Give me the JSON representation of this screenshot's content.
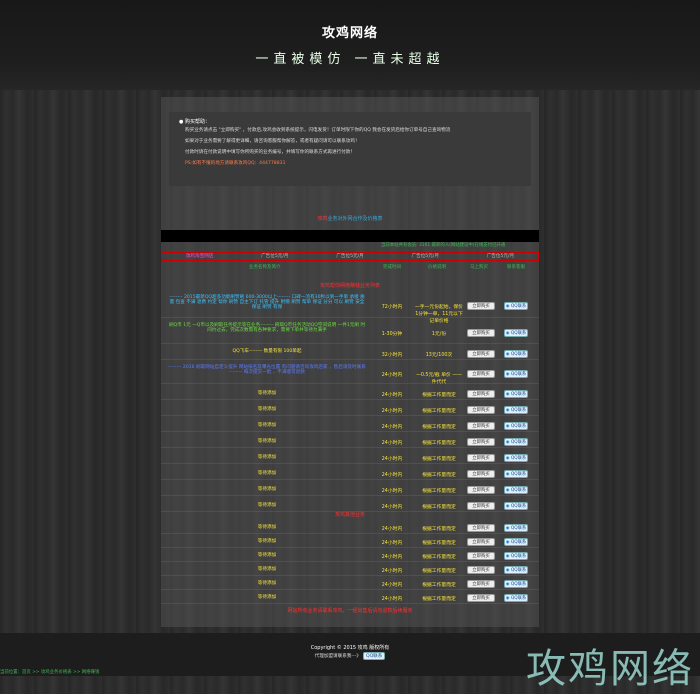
{
  "header": {
    "site_name": "攻鸡网络",
    "slogan": "一直被模仿 一直未超越"
  },
  "notice": {
    "title": "购买帮助：",
    "lines": [
      "购买业务请点击 \"立即购买\" ，付款后,攻鸡会收到系统提示，闪电发货！订单时限下你的QQ 我会在发货后给你订单号自己查询物流",
      "如果对于业务需要了解得更详细，请咨询客服帮你解答，或者有疑问请可以联系攻鸡！",
      "付款时请在付款说明中填写你所购买的业务编号，并填写你的联系方式再进行付款！",
      "PS:如有不懂的地方请联系攻鸡QQ：444778831"
    ]
  },
  "subtitle": {
    "red": "攻鸡",
    "rest": "业务对外网合作及价格表"
  },
  "stats": "当前本站共有会员: 3161 最新的人(网站建设中)在线支付已开通",
  "ads": [
    "攻鸡淘宝网店",
    "广告位5元/月",
    "广告位5元/月",
    "广告位5元/月",
    "广告位5元/月"
  ],
  "columns": [
    "业务名称及简介",
    "完成时间",
    "价格说明",
    "马上购买",
    "联系客服"
  ],
  "section_title": "攻鸡帮你网络赚钱业务列表",
  "section2_title": "攻鸡其他业务",
  "buy_label": "立即购买",
  "qq_label": "QQ联系",
  "rows": [
    {
      "desc": "-------- 2015最新QQ超多功能刷赞刷 600-3000以上-------- 口碑一流有30秒以到一手单 承接 质量 包查 不满 退费 约定 帮你 刷赞 自主下订 托管 提升 附赠 刷赞 帮单 保证 分分 可以 刷赞 安全 保证 刷赞 有保",
      "time": "72小时内",
      "price": "一手一元份起始，保价1分钟一单，11元以下记单价格",
      "h": 24
    },
    {
      "desc": "刷Q币 1元 一Q币以及刷取任务提示等在业务-------- 刷取Q币任务活动QQ空间说明 一件1元刷 时间约过去，完成次数需有各种要求，需要下单并等待为满手",
      "time": "1-30分钟",
      "price": "1元/份",
      "h": 22
    },
    {
      "desc": "QQ飞车-------- 数量有限 100单起",
      "time": "32小时内",
      "price": "13元/100次",
      "h": 12
    },
    {
      "desc": "-------- 2016 刷取网站自定义提升 网站排名及曝光位置 有问题请咨询攻鸡店家 ，售后请及时联系 -------- 每次提交一批 ，不满意可退款",
      "time": "24小时内",
      "price": "一0.5元/截 单价 一一件代代",
      "h": 20
    },
    {
      "desc": "等待添加",
      "time": "24小时内",
      "price": "根据工作量而定",
      "h": 12
    },
    {
      "desc": "等待添加",
      "time": "24小时内",
      "price": "根据工作量而定",
      "h": 12
    },
    {
      "desc": "等待添加",
      "time": "24小时内",
      "price": "根据工作量而定",
      "h": 12
    },
    {
      "desc": "等待添加",
      "time": "24小时内",
      "price": "根据工作量而定",
      "h": 12
    },
    {
      "desc": "等待添加",
      "time": "24小时内",
      "price": "根据工作量而定",
      "h": 12
    },
    {
      "desc": "等待添加",
      "time": "24小时内",
      "price": "根据工作量而定",
      "h": 12
    },
    {
      "desc": "等待添加",
      "time": "24小时内",
      "price": "根据工作量而定",
      "h": 12
    },
    {
      "desc": "等待添加",
      "time": "24小时内",
      "price": "根据工作量而定",
      "h": 12
    }
  ],
  "rows2": [
    {
      "desc": "等待添加",
      "time": "24小时内",
      "price": "根据工作量而定"
    },
    {
      "desc": "等待添加",
      "time": "24小时内",
      "price": "根据工作量而定"
    },
    {
      "desc": "等待添加",
      "time": "24小时内",
      "price": "根据工作量而定"
    },
    {
      "desc": "等待添加",
      "time": "24小时内",
      "price": "根据工作量而定"
    },
    {
      "desc": "等待添加",
      "time": "24小时内",
      "price": "根据工作量而定"
    },
    {
      "desc": "等待添加",
      "time": "24小时内",
      "price": "根据工作量而定"
    }
  ],
  "bottom_note": "网站所有业务请联系攻鸡，一经出售后请勿退款后续服务",
  "footer": {
    "copyright": "Copyright © 2015 攻鸡 版权所有",
    "agent": "代理加盟请联系我---》",
    "qq": "QQ联系"
  },
  "brand_mark": "攻鸡网络",
  "breadcrumb": "当前位置：首页 >> 攻鸡业务价格表 >> 网络赚钱"
}
